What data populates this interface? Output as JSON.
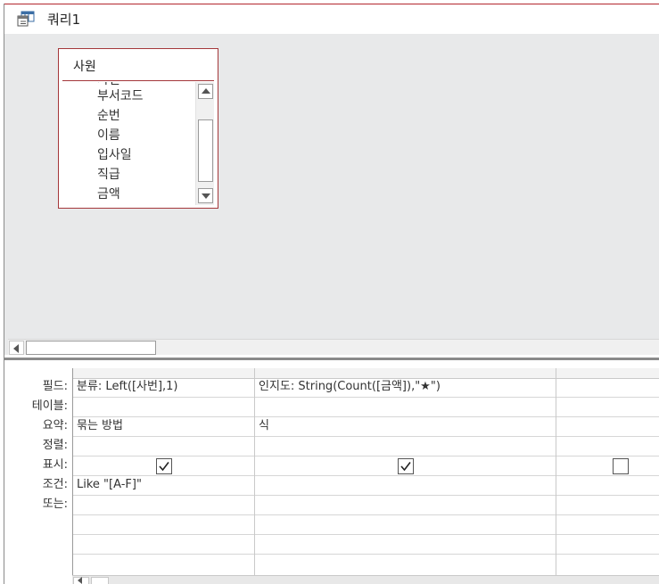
{
  "window": {
    "title": "쿼리1",
    "icon": "query-icon"
  },
  "table": {
    "name": "사원",
    "fields": [
      "사번",
      "부서코드",
      "순번",
      "이름",
      "입사일",
      "직급",
      "금액"
    ]
  },
  "grid": {
    "row_labels": [
      "필드:",
      "테이블:",
      "요약:",
      "정렬:",
      "표시:",
      "조건:",
      "또는:"
    ],
    "columns": [
      {
        "field": "분류: Left([사번],1)",
        "table": "",
        "total": "묶는 방법",
        "sort": "",
        "show": true,
        "criteria": "Like \"[A-F]\"",
        "or": ""
      },
      {
        "field": "인지도: String(Count([금액]),\"★\")",
        "table": "",
        "total": "식",
        "sort": "",
        "show": true,
        "criteria": "",
        "or": ""
      },
      {
        "field": "",
        "table": "",
        "total": "",
        "sort": "",
        "show": false,
        "criteria": "",
        "or": ""
      }
    ]
  }
}
